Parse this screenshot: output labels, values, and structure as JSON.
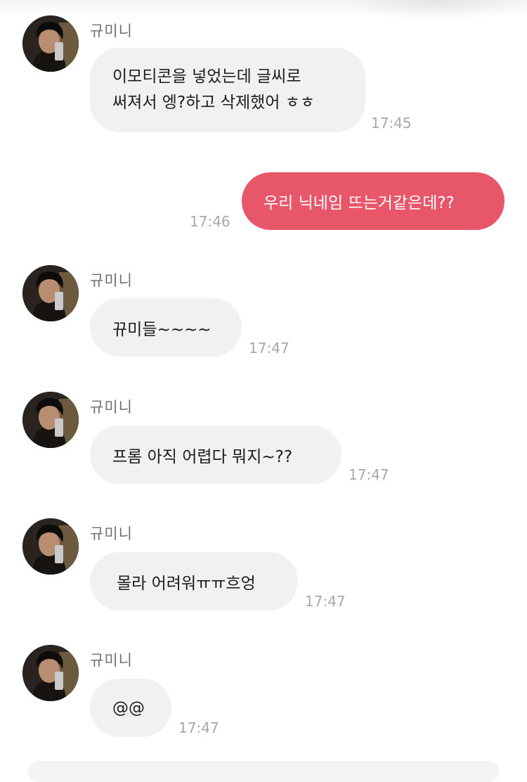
{
  "sender": {
    "name": "규미니"
  },
  "messages": [
    {
      "direction": "in",
      "lines": [
        "이모티콘을 넣었는데 글씨로",
        "써져서 엥?하고 삭제했어 ㅎㅎ"
      ],
      "time": "17:45"
    },
    {
      "direction": "out",
      "text": "우리 닉네임 뜨는거같은데??",
      "time": "17:46"
    },
    {
      "direction": "in",
      "text": "뀨미들~~~~",
      "time": "17:47"
    },
    {
      "direction": "in",
      "text": "프롬 아직 어렵다 뭐지~??",
      "time": "17:47"
    },
    {
      "direction": "in",
      "text": "몰라 어려워ㅠㅠ흐엉",
      "time": "17:47"
    },
    {
      "direction": "in",
      "text": "@@",
      "time": "17:47"
    }
  ],
  "colors": {
    "incoming_bubble": "#f1f1f3",
    "outgoing_bubble": "#e8566a",
    "timestamp": "#a8a8ad",
    "sender_name": "#6e6e73"
  },
  "icons": {
    "avatar": "profile-photo"
  }
}
